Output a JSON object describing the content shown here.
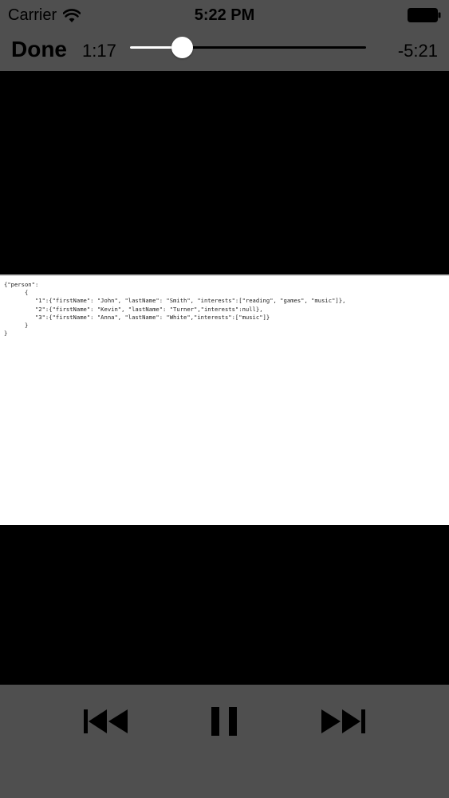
{
  "status_bar": {
    "carrier": "Carrier",
    "time": "5:22 PM",
    "wifi_icon": "wifi-icon",
    "battery_icon": "battery-icon"
  },
  "player": {
    "done_label": "Done",
    "elapsed": "1:17",
    "remaining": "-5:21",
    "progress_fraction": 0.22
  },
  "video_content": {
    "code_lines": [
      "{\"person\":",
      "      {",
      "         \"1\":{\"firstName\": \"John\", \"lastName\": \"Smith\", \"interests\":[\"reading\", \"games\", \"music\"]},",
      "         \"2\":{\"firstName\": \"Kevin\", \"lastName\": \"Turner\",\"interests\":null},",
      "         \"3\":{\"firstName\": \"Anna\", \"lastName\": \"White\",\"interests\":[\"music\"]}",
      "      }",
      "}"
    ]
  },
  "transport": {
    "rewind_icon": "rewind-icon",
    "pause_icon": "pause-icon",
    "forward_icon": "fast-forward-icon"
  },
  "colors": {
    "bar_background": "#4f4f4f",
    "video_background": "#000000",
    "scrubber_fill": "#ffffff"
  }
}
